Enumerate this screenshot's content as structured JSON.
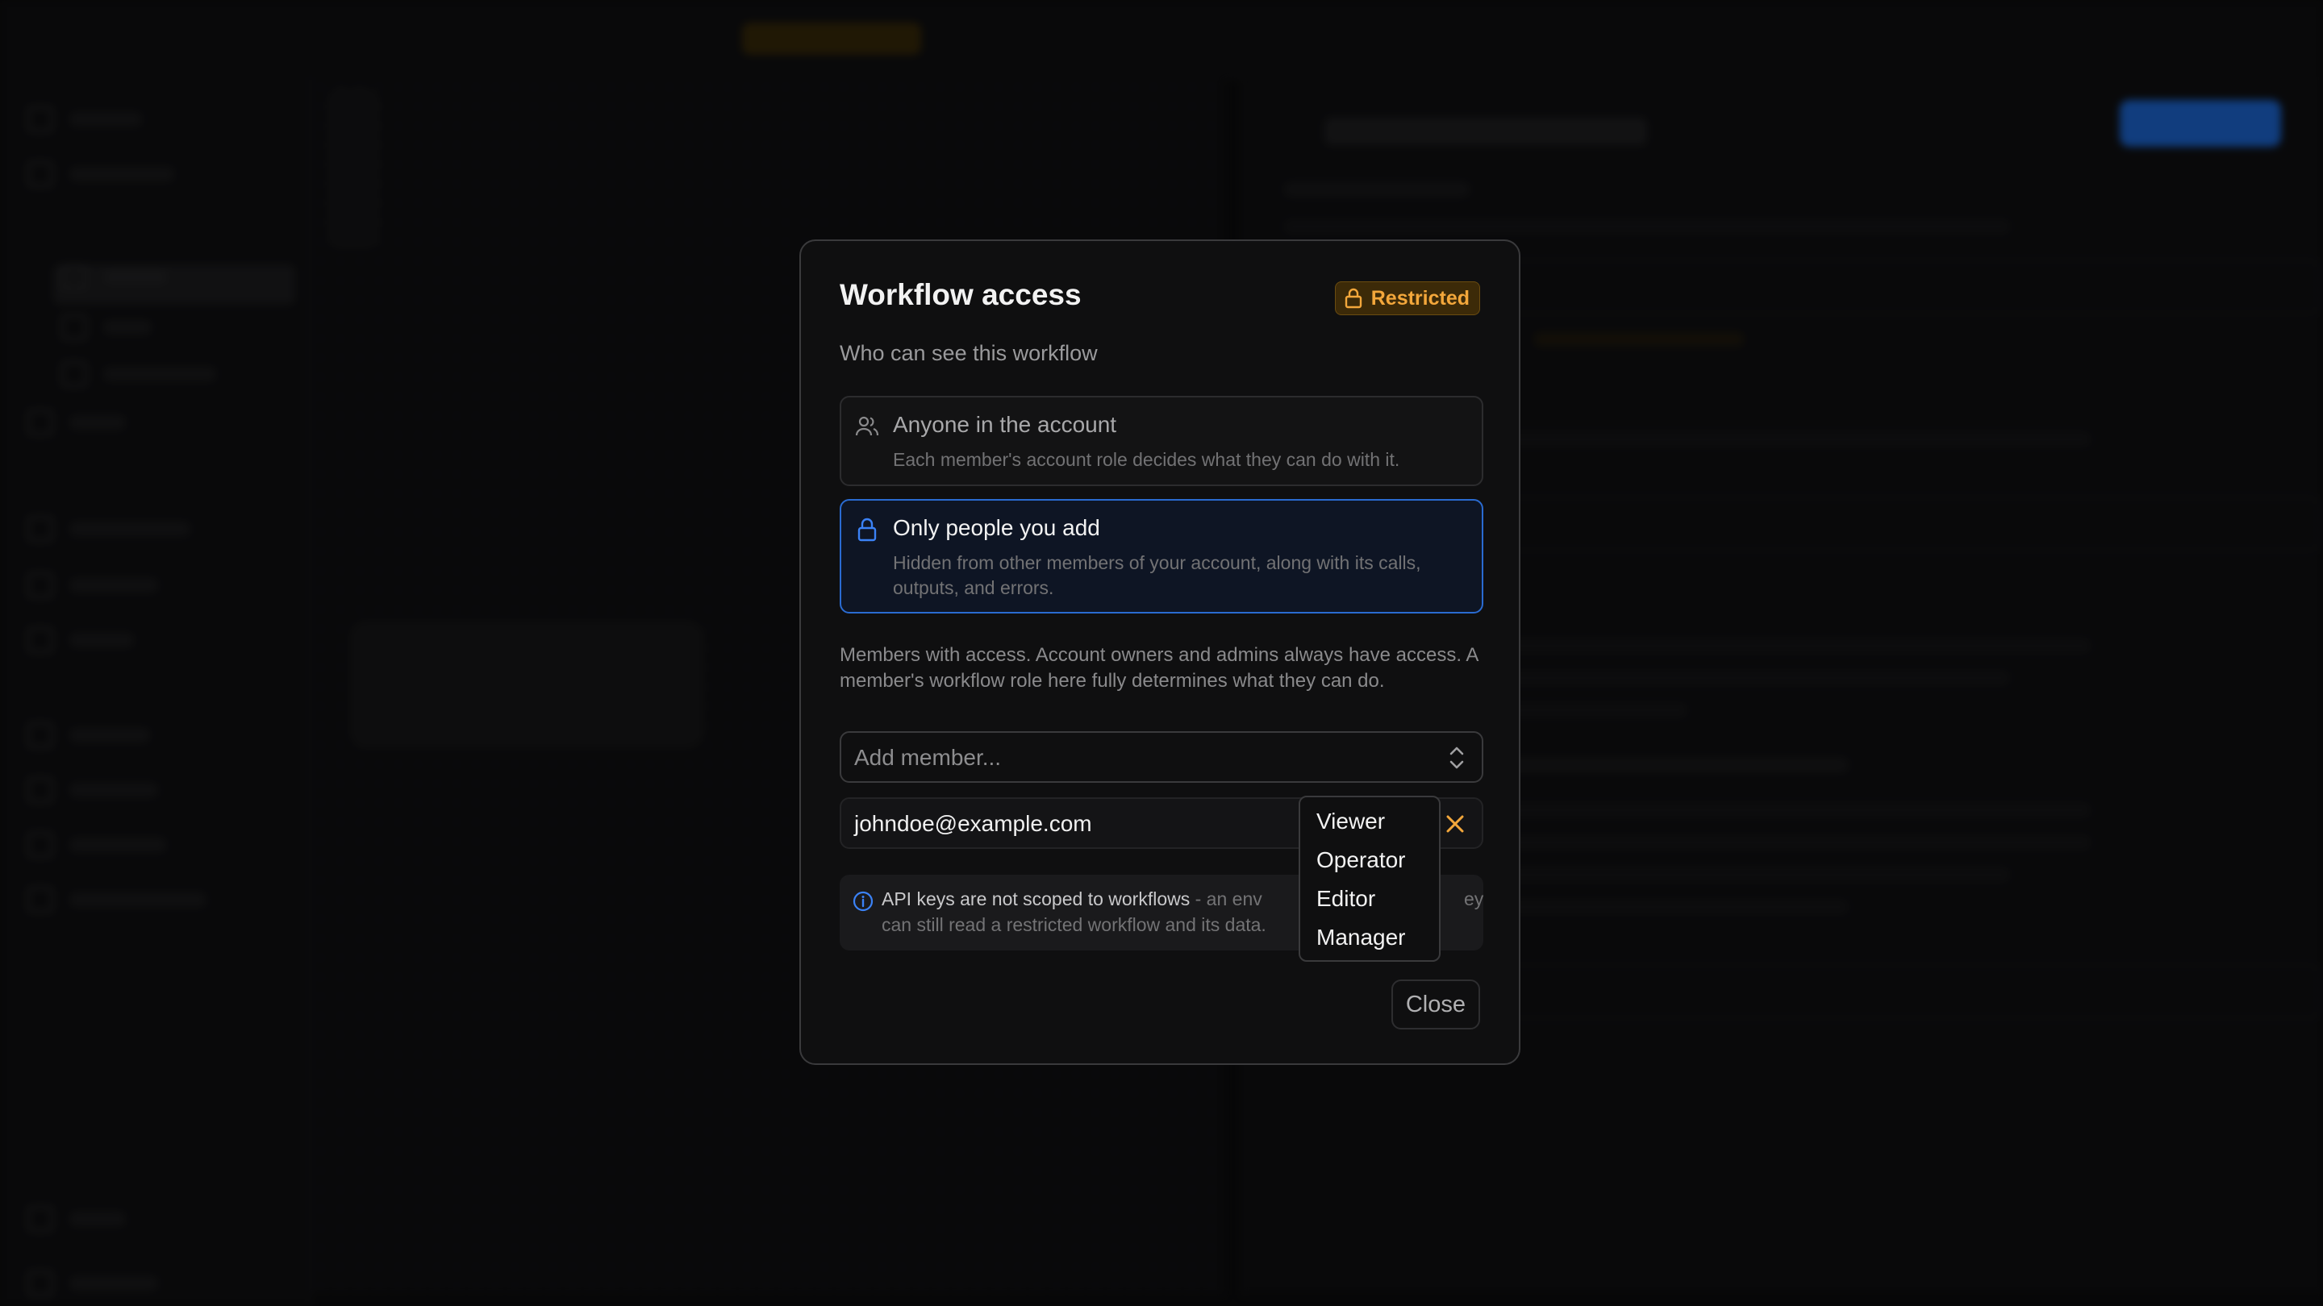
{
  "modal": {
    "title": "Workflow access",
    "badge": "Restricted",
    "subtitle": "Who can see this workflow",
    "options": [
      {
        "title": "Anyone in the account",
        "desc": "Each member's account role decides what they can do with it.",
        "selected": false
      },
      {
        "title": "Only people you add",
        "desc": "Hidden from other members of your account, along with its calls, outputs, and errors.",
        "selected": true
      }
    ],
    "help_text": "Members with access. Account owners and admins always have access. A member's workflow role here fully determines what they can do.",
    "add_member_placeholder": "Add member...",
    "member_email": "johndoe@example.com",
    "note_strong": "API keys are not scoped to workflows",
    "note_rest": " - an env",
    "note_line2": "can still read a restricted workflow and its data.",
    "note_tail": "ey",
    "close_label": "Close"
  },
  "role_dropdown": {
    "options": [
      "Viewer",
      "Operator",
      "Editor",
      "Manager"
    ]
  },
  "colors": {
    "accent_blue": "#2a6bd1",
    "warning_orange": "#f3a73b",
    "modal_bg": "#0f0f10"
  }
}
